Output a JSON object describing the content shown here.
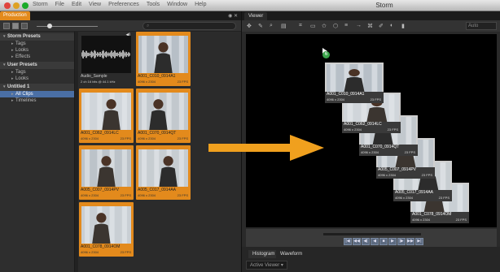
{
  "window": {
    "title": "Storm",
    "menu": [
      "Storm",
      "File",
      "Edit",
      "View",
      "Preferences",
      "Tools",
      "Window",
      "Help"
    ]
  },
  "left": {
    "tab": "Production",
    "search_placeholder": "",
    "tree": [
      {
        "label": "Storm Presets",
        "kind": "hdr"
      },
      {
        "label": "Tags",
        "kind": "sub"
      },
      {
        "label": "Looks",
        "kind": "sub"
      },
      {
        "label": "Effects",
        "kind": "sub"
      },
      {
        "label": "User Presets",
        "kind": "hdr"
      },
      {
        "label": "Tags",
        "kind": "sub"
      },
      {
        "label": "Looks",
        "kind": "sub"
      },
      {
        "label": "Untitled 1",
        "kind": "hdr"
      },
      {
        "label": "All Clips",
        "kind": "sub",
        "selected": true
      },
      {
        "label": "Timelines",
        "kind": "sub"
      }
    ],
    "clips": [
      {
        "name": "Audio_Sample",
        "meta": "2 ch 16 bits @ 44.1 kHz",
        "fps": "",
        "audio": true
      },
      {
        "name": "A001_C010_0914A1",
        "meta": "4096 x 2304",
        "fps": "23 FPS"
      },
      {
        "name": "A001_C062_0914LC",
        "meta": "4096 x 2304",
        "fps": "23 FPS"
      },
      {
        "name": "A001_C070_0914QT",
        "meta": "4096 x 2304",
        "fps": "23 FPS"
      },
      {
        "name": "A005_C007_0914PV",
        "meta": "4096 x 2304",
        "fps": "23 FPS"
      },
      {
        "name": "A005_C017_0914AA",
        "meta": "4096 x 2304",
        "fps": "23 FPS"
      },
      {
        "name": "A001_C078_0914OM",
        "meta": "4096 x 2304",
        "fps": "23 FPS"
      }
    ]
  },
  "right": {
    "tab": "Viewer",
    "zoom": "Auto",
    "badge": "6",
    "stack": [
      {
        "name": "A001_C010_0914A1",
        "meta": "4096 x 2304",
        "fps": "23 FPS"
      },
      {
        "name": "A001_C062_0914LC",
        "meta": "4096 x 2304",
        "fps": "23 FPS"
      },
      {
        "name": "A001_C070_0914QT",
        "meta": "4096 x 2304",
        "fps": "23 FPS"
      },
      {
        "name": "A005_C007_0914PV",
        "meta": "4096 x 2304",
        "fps": "23 FPS"
      },
      {
        "name": "A005_C017_0914AA",
        "meta": "4096 x 2304",
        "fps": "23 FPS"
      },
      {
        "name": "A001_C078_0914OM",
        "meta": "4096 x 2304",
        "fps": "23 FPS"
      }
    ],
    "bottom_tabs": [
      "Histogram",
      "Waveform"
    ],
    "bottom_select": "Active Viewer",
    "transport": [
      "|◀",
      "◀◀",
      "◀|",
      "◀",
      "■",
      "▶",
      "|▶",
      "▶▶",
      "▶|"
    ]
  },
  "colors": {
    "accent": "#e38a1c",
    "arrow": "#f0a01e"
  }
}
